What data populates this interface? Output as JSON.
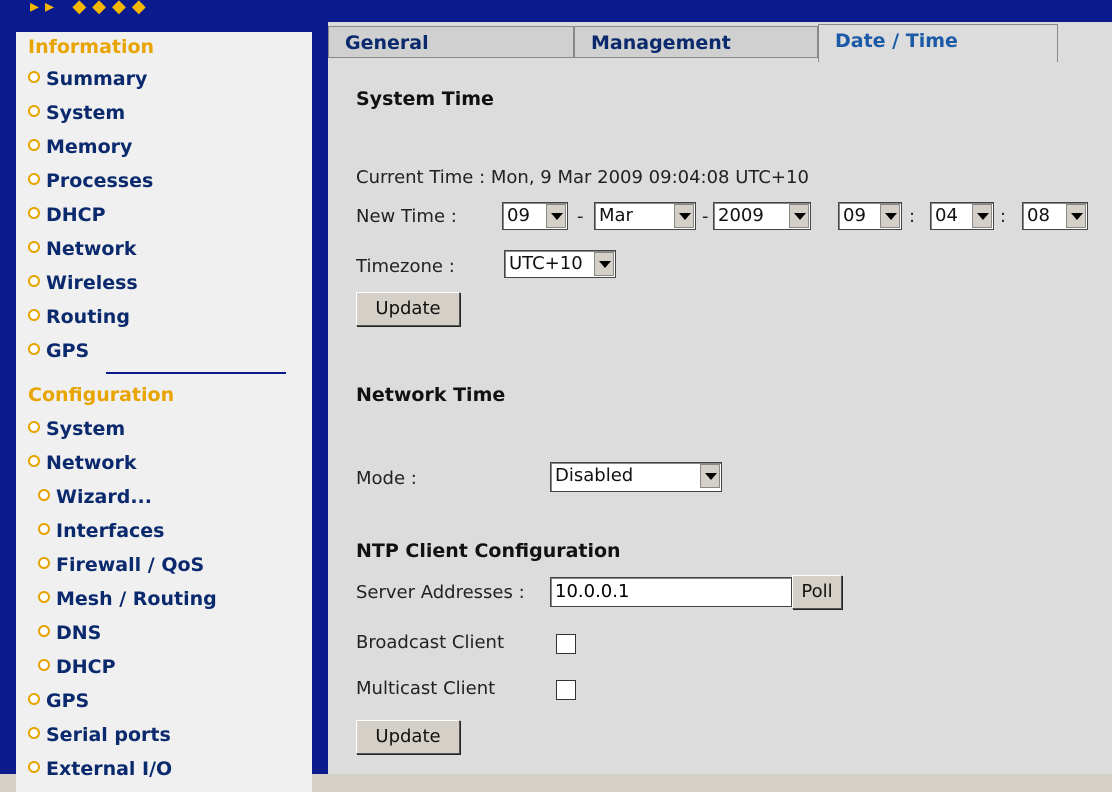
{
  "header": {
    "logo_fragment": "▸▸ ◆◆◆◆"
  },
  "sidebar": {
    "information_title": "Information",
    "information_items": [
      {
        "label": "Summary"
      },
      {
        "label": "System"
      },
      {
        "label": "Memory"
      },
      {
        "label": "Processes"
      },
      {
        "label": "DHCP"
      },
      {
        "label": "Network"
      },
      {
        "label": "Wireless"
      },
      {
        "label": "Routing"
      },
      {
        "label": "GPS"
      }
    ],
    "configuration_title": "Configuration",
    "configuration_items": [
      {
        "label": "System"
      },
      {
        "label": "Network"
      },
      {
        "label": "Wizard..."
      },
      {
        "label": "Interfaces"
      },
      {
        "label": "Firewall / QoS"
      },
      {
        "label": "Mesh / Routing"
      },
      {
        "label": "DNS"
      },
      {
        "label": "DHCP"
      },
      {
        "label": "GPS"
      },
      {
        "label": "Serial ports"
      },
      {
        "label": "External I/O"
      }
    ]
  },
  "tabs": [
    {
      "label": "General"
    },
    {
      "label": "Management"
    },
    {
      "label": "Date / Time"
    }
  ],
  "system_time": {
    "title": "System Time",
    "current_time_label": "Current Time : Mon, 9 Mar 2009 09:04:08 UTC+10",
    "new_time_label": "New Time :",
    "day": "09",
    "month": "Mar",
    "year": "2009",
    "hour": "09",
    "minute": "04",
    "second": "08",
    "dash": "-",
    "colon": ":",
    "timezone_label": "Timezone :",
    "timezone": "UTC+10",
    "update_label": "Update"
  },
  "network_time": {
    "title": "Network Time",
    "mode_label": "Mode :",
    "mode_value": "Disabled",
    "ntp_title": "NTP Client Configuration",
    "server_label": "Server Addresses :",
    "server_value": "10.0.0.1",
    "poll_label": "Poll",
    "broadcast_label": "Broadcast Client",
    "multicast_label": "Multicast Client",
    "update_label": "Update"
  },
  "colors": {
    "frame_blue": "#0b1a8c",
    "section_orange": "#e8a400",
    "nav_text": "#0b2a6e"
  }
}
